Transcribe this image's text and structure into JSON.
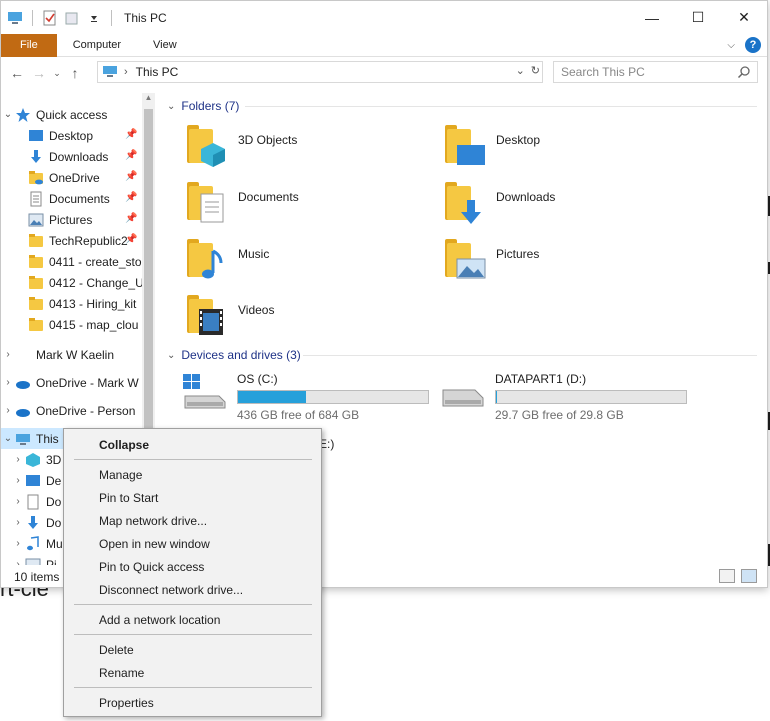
{
  "window": {
    "title": "This PC",
    "controls": {
      "minimize": "—",
      "maximize": "☐",
      "close": "✕"
    }
  },
  "ribbon": {
    "tabs": [
      "File",
      "Computer",
      "View"
    ]
  },
  "address": {
    "path": "This PC",
    "search_placeholder": "Search This PC"
  },
  "nav": {
    "quick_access": "Quick access",
    "quick_items": [
      "Desktop",
      "Downloads",
      "OneDrive",
      "Documents",
      "Pictures",
      "TechRepublic2",
      "0411 - create_sto",
      "0412 - Change_U",
      "0413 - Hiring_kit",
      "0415 - map_clou"
    ],
    "account": "Mark W Kaelin",
    "onedrive_mark": "OneDrive - Mark W",
    "onedrive_personal": "OneDrive - Person",
    "this_pc": "This",
    "pc_children": [
      "3D",
      "De",
      "Do",
      "Do",
      "Mu",
      "Pi"
    ]
  },
  "content": {
    "folders_header": "Folders (7)",
    "folders": [
      {
        "label": "3D Objects",
        "icon": "3d-objects-icon"
      },
      {
        "label": "Desktop",
        "icon": "desktop-icon"
      },
      {
        "label": "Documents",
        "icon": "documents-icon"
      },
      {
        "label": "Downloads",
        "icon": "downloads-icon"
      },
      {
        "label": "Music",
        "icon": "music-icon"
      },
      {
        "label": "Pictures",
        "icon": "pictures-icon"
      },
      {
        "label": "Videos",
        "icon": "videos-icon"
      }
    ],
    "drives_header": "Devices and drives (3)",
    "drives": [
      {
        "name": "OS (C:)",
        "free": "436 GB free of 684 GB",
        "used_fraction": 0.36
      },
      {
        "name": "DATAPART1 (D:)",
        "free": "29.7 GB free of 29.8 GB",
        "used_fraction": 0.003
      }
    ],
    "partial_drive_label": "E:)"
  },
  "status": {
    "items": "10 items"
  },
  "context_menu": {
    "items": [
      "Collapse",
      "Manage",
      "Pin to Start",
      "Map network drive...",
      "Open in new window",
      "Pin to Quick access",
      "Disconnect network drive...",
      "Add a network location",
      "Delete",
      "Rename",
      "Properties"
    ]
  },
  "backdrop": {
    "text": "rt-cle"
  },
  "colors": {
    "file_tab": "#c16a13",
    "accent": "#26a0da",
    "group_header": "#1e3287"
  }
}
